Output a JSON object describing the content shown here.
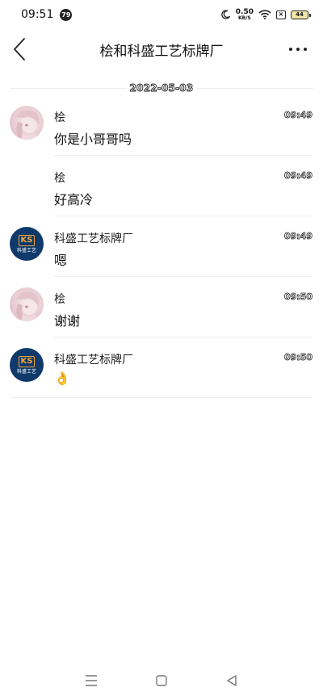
{
  "status_bar": {
    "time": "09:51",
    "notification_count": "79",
    "net_speed_value": "0.50",
    "net_speed_unit": "KB/S",
    "battery": "44"
  },
  "header": {
    "title": "桧和科盛工艺标牌厂"
  },
  "date_divider": "2022-05-03",
  "messages": [
    {
      "sender": "桧",
      "time": "09:49",
      "content": "你是小哥哥吗",
      "avatar": "girl-avatar"
    },
    {
      "sender": "桧",
      "time": "09:49",
      "content": "好高冷",
      "avatar": ""
    },
    {
      "sender": "科盛工艺标牌厂",
      "time": "09:49",
      "content": "嗯",
      "avatar": "brand-logo"
    },
    {
      "sender": "桧",
      "time": "09:50",
      "content": "谢谢",
      "avatar": "girl-avatar"
    },
    {
      "sender": "科盛工艺标牌厂",
      "time": "09:50",
      "content": "👌",
      "avatar": "brand-logo"
    }
  ],
  "brand_logo": {
    "mark": "KS",
    "name": "科盛工艺"
  },
  "colors": {
    "brand_bg": "#0f3a6b",
    "brand_accent": "#f2a23a",
    "divider": "#eeeeee"
  }
}
